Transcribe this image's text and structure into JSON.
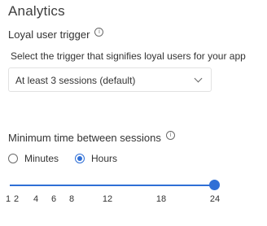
{
  "title": "Analytics",
  "loyal": {
    "label": "Loyal user trigger",
    "info_icon": "info-icon",
    "description": "Select the trigger that signifies loyal users for your app",
    "select_value": "At least 3 sessions (default)",
    "select_icon": "chevron-down-icon"
  },
  "sessions": {
    "label": "Minimum time between sessions",
    "info_icon": "info-icon",
    "options": [
      {
        "label": "Minutes",
        "selected": false
      },
      {
        "label": "Hours",
        "selected": true
      }
    ],
    "slider": {
      "value": 24,
      "min": 1,
      "max": 24,
      "ticks": [
        "1",
        "2",
        "4",
        "6",
        "8",
        "12",
        "18",
        "24"
      ]
    }
  },
  "colors": {
    "accent": "#2f6fd6",
    "text": "#333333",
    "border": "#e2e2e2"
  }
}
